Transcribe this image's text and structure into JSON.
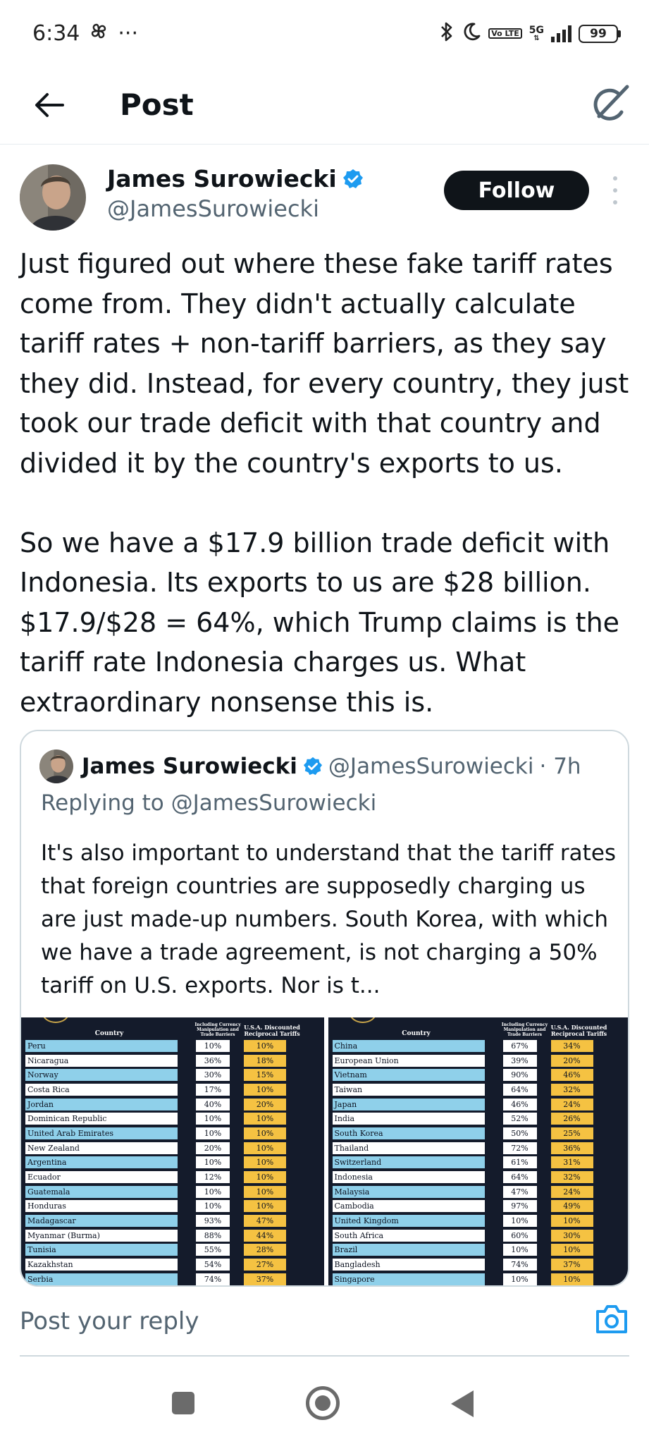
{
  "status_bar": {
    "time": "6:34",
    "more": "···",
    "network": "5G",
    "volte": "Vo LTE",
    "battery": "99"
  },
  "header": {
    "title": "Post"
  },
  "post": {
    "author_name": "James Surowiecki",
    "author_handle": "@JamesSurowiecki",
    "follow_label": "Follow",
    "text": "Just figured out where these fake tariff rates come from. They didn't actually calculate tariff rates + non-tariff barriers, as they say they did. Instead, for every country, they just took our trade deficit with that country and divided it by the country's exports to us.\n\nSo we have a $17.9 billion trade deficit with Indonesia. Its exports to us are $28 billion. $17.9/$28 = 64%, which Trump claims is the tariff rate Indonesia charges us. What extraordinary nonsense this is."
  },
  "quote": {
    "author_name": "James Surowiecki",
    "author_handle": "@JamesSurowiecki",
    "time": "· 7h",
    "replying_to": "Replying to @JamesSurowiecki",
    "text": "It's also important to understand that the tariff rates that foreign countries are supposedly charging us are just made-up numbers. South Korea, with which we have a trade agreement, is not charging a 50% tariff on U.S. exports. Nor is t..."
  },
  "tariff_table": {
    "header_country": "Country",
    "header_rate": "Including Currency Manipulation and Trade Barriers",
    "header_discount": "U.S.A. Discounted Reciprocal Tariffs",
    "left": [
      {
        "country": "Peru",
        "rate": "10%",
        "discount": "10%"
      },
      {
        "country": "Nicaragua",
        "rate": "36%",
        "discount": "18%"
      },
      {
        "country": "Norway",
        "rate": "30%",
        "discount": "15%"
      },
      {
        "country": "Costa Rica",
        "rate": "17%",
        "discount": "10%"
      },
      {
        "country": "Jordan",
        "rate": "40%",
        "discount": "20%"
      },
      {
        "country": "Dominican Republic",
        "rate": "10%",
        "discount": "10%"
      },
      {
        "country": "United Arab Emirates",
        "rate": "10%",
        "discount": "10%"
      },
      {
        "country": "New Zealand",
        "rate": "20%",
        "discount": "10%"
      },
      {
        "country": "Argentina",
        "rate": "10%",
        "discount": "10%"
      },
      {
        "country": "Ecuador",
        "rate": "12%",
        "discount": "10%"
      },
      {
        "country": "Guatemala",
        "rate": "10%",
        "discount": "10%"
      },
      {
        "country": "Honduras",
        "rate": "10%",
        "discount": "10%"
      },
      {
        "country": "Madagascar",
        "rate": "93%",
        "discount": "47%"
      },
      {
        "country": "Myanmar (Burma)",
        "rate": "88%",
        "discount": "44%"
      },
      {
        "country": "Tunisia",
        "rate": "55%",
        "discount": "28%"
      },
      {
        "country": "Kazakhstan",
        "rate": "54%",
        "discount": "27%"
      },
      {
        "country": "Serbia",
        "rate": "74%",
        "discount": "37%"
      }
    ],
    "right": [
      {
        "country": "China",
        "rate": "67%",
        "discount": "34%"
      },
      {
        "country": "European Union",
        "rate": "39%",
        "discount": "20%"
      },
      {
        "country": "Vietnam",
        "rate": "90%",
        "discount": "46%"
      },
      {
        "country": "Taiwan",
        "rate": "64%",
        "discount": "32%"
      },
      {
        "country": "Japan",
        "rate": "46%",
        "discount": "24%"
      },
      {
        "country": "India",
        "rate": "52%",
        "discount": "26%"
      },
      {
        "country": "South Korea",
        "rate": "50%",
        "discount": "25%"
      },
      {
        "country": "Thailand",
        "rate": "72%",
        "discount": "36%"
      },
      {
        "country": "Switzerland",
        "rate": "61%",
        "discount": "31%"
      },
      {
        "country": "Indonesia",
        "rate": "64%",
        "discount": "32%"
      },
      {
        "country": "Malaysia",
        "rate": "47%",
        "discount": "24%"
      },
      {
        "country": "Cambodia",
        "rate": "97%",
        "discount": "49%"
      },
      {
        "country": "United Kingdom",
        "rate": "10%",
        "discount": "10%"
      },
      {
        "country": "South Africa",
        "rate": "60%",
        "discount": "30%"
      },
      {
        "country": "Brazil",
        "rate": "10%",
        "discount": "10%"
      },
      {
        "country": "Bangladesh",
        "rate": "74%",
        "discount": "37%"
      },
      {
        "country": "Singapore",
        "rate": "10%",
        "discount": "10%"
      }
    ]
  },
  "reply": {
    "placeholder": "Post your reply"
  },
  "colors": {
    "verified": "#1d9bf0",
    "follow_bg": "#0f1419",
    "table_bg": "#141b2b",
    "table_country": "#8fd0ea",
    "table_discount": "#f5c242",
    "camera": "#1d9bf0"
  },
  "icons": {
    "back": "arrow-left-icon",
    "grok": "grok-icon",
    "verified": "verified-badge-icon",
    "more": "more-vertical-icon",
    "camera": "camera-icon",
    "bluetooth": "bluetooth-icon",
    "dnd": "moon-icon",
    "signal": "signal-icon",
    "battery": "battery-icon"
  }
}
